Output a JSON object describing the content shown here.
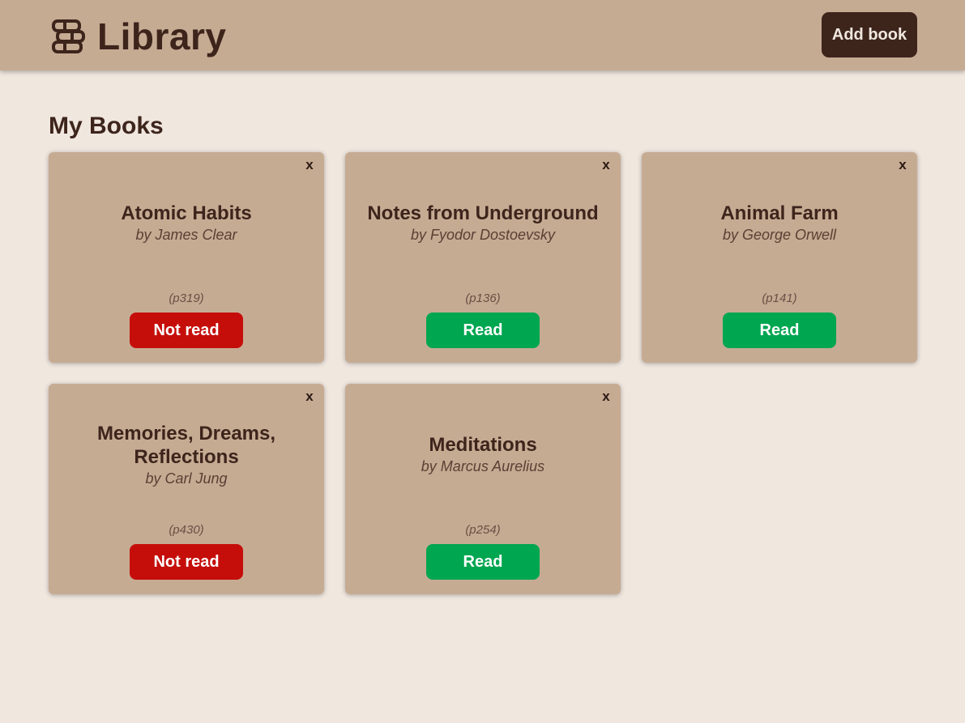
{
  "header": {
    "title": "Library",
    "add_label": "Add book",
    "logo_icon": "books-stack-icon"
  },
  "main": {
    "section_title": "My Books"
  },
  "colors": {
    "background": "#f0e7df",
    "header": "#c6ab93",
    "card": "#c6ab93",
    "text": "#3d251c",
    "read": "#00a650",
    "not_read": "#c50e0a"
  },
  "books": [
    {
      "title": "Atomic Habits",
      "author": "by James Clear",
      "pages": "(p319)",
      "status": "Not read",
      "is_read": false,
      "close_label": "x"
    },
    {
      "title": "Notes from Underground",
      "author": "by Fyodor Dostoevsky",
      "pages": "(p136)",
      "status": "Read",
      "is_read": true,
      "close_label": "x"
    },
    {
      "title": "Animal Farm",
      "author": "by George Orwell",
      "pages": "(p141)",
      "status": "Read",
      "is_read": true,
      "close_label": "x"
    },
    {
      "title": "Memories, Dreams, Reflections",
      "author": "by Carl Jung",
      "pages": "(p430)",
      "status": "Not read",
      "is_read": false,
      "close_label": "x"
    },
    {
      "title": "Meditations",
      "author": "by Marcus Aurelius",
      "pages": "(p254)",
      "status": "Read",
      "is_read": true,
      "close_label": "x"
    }
  ]
}
